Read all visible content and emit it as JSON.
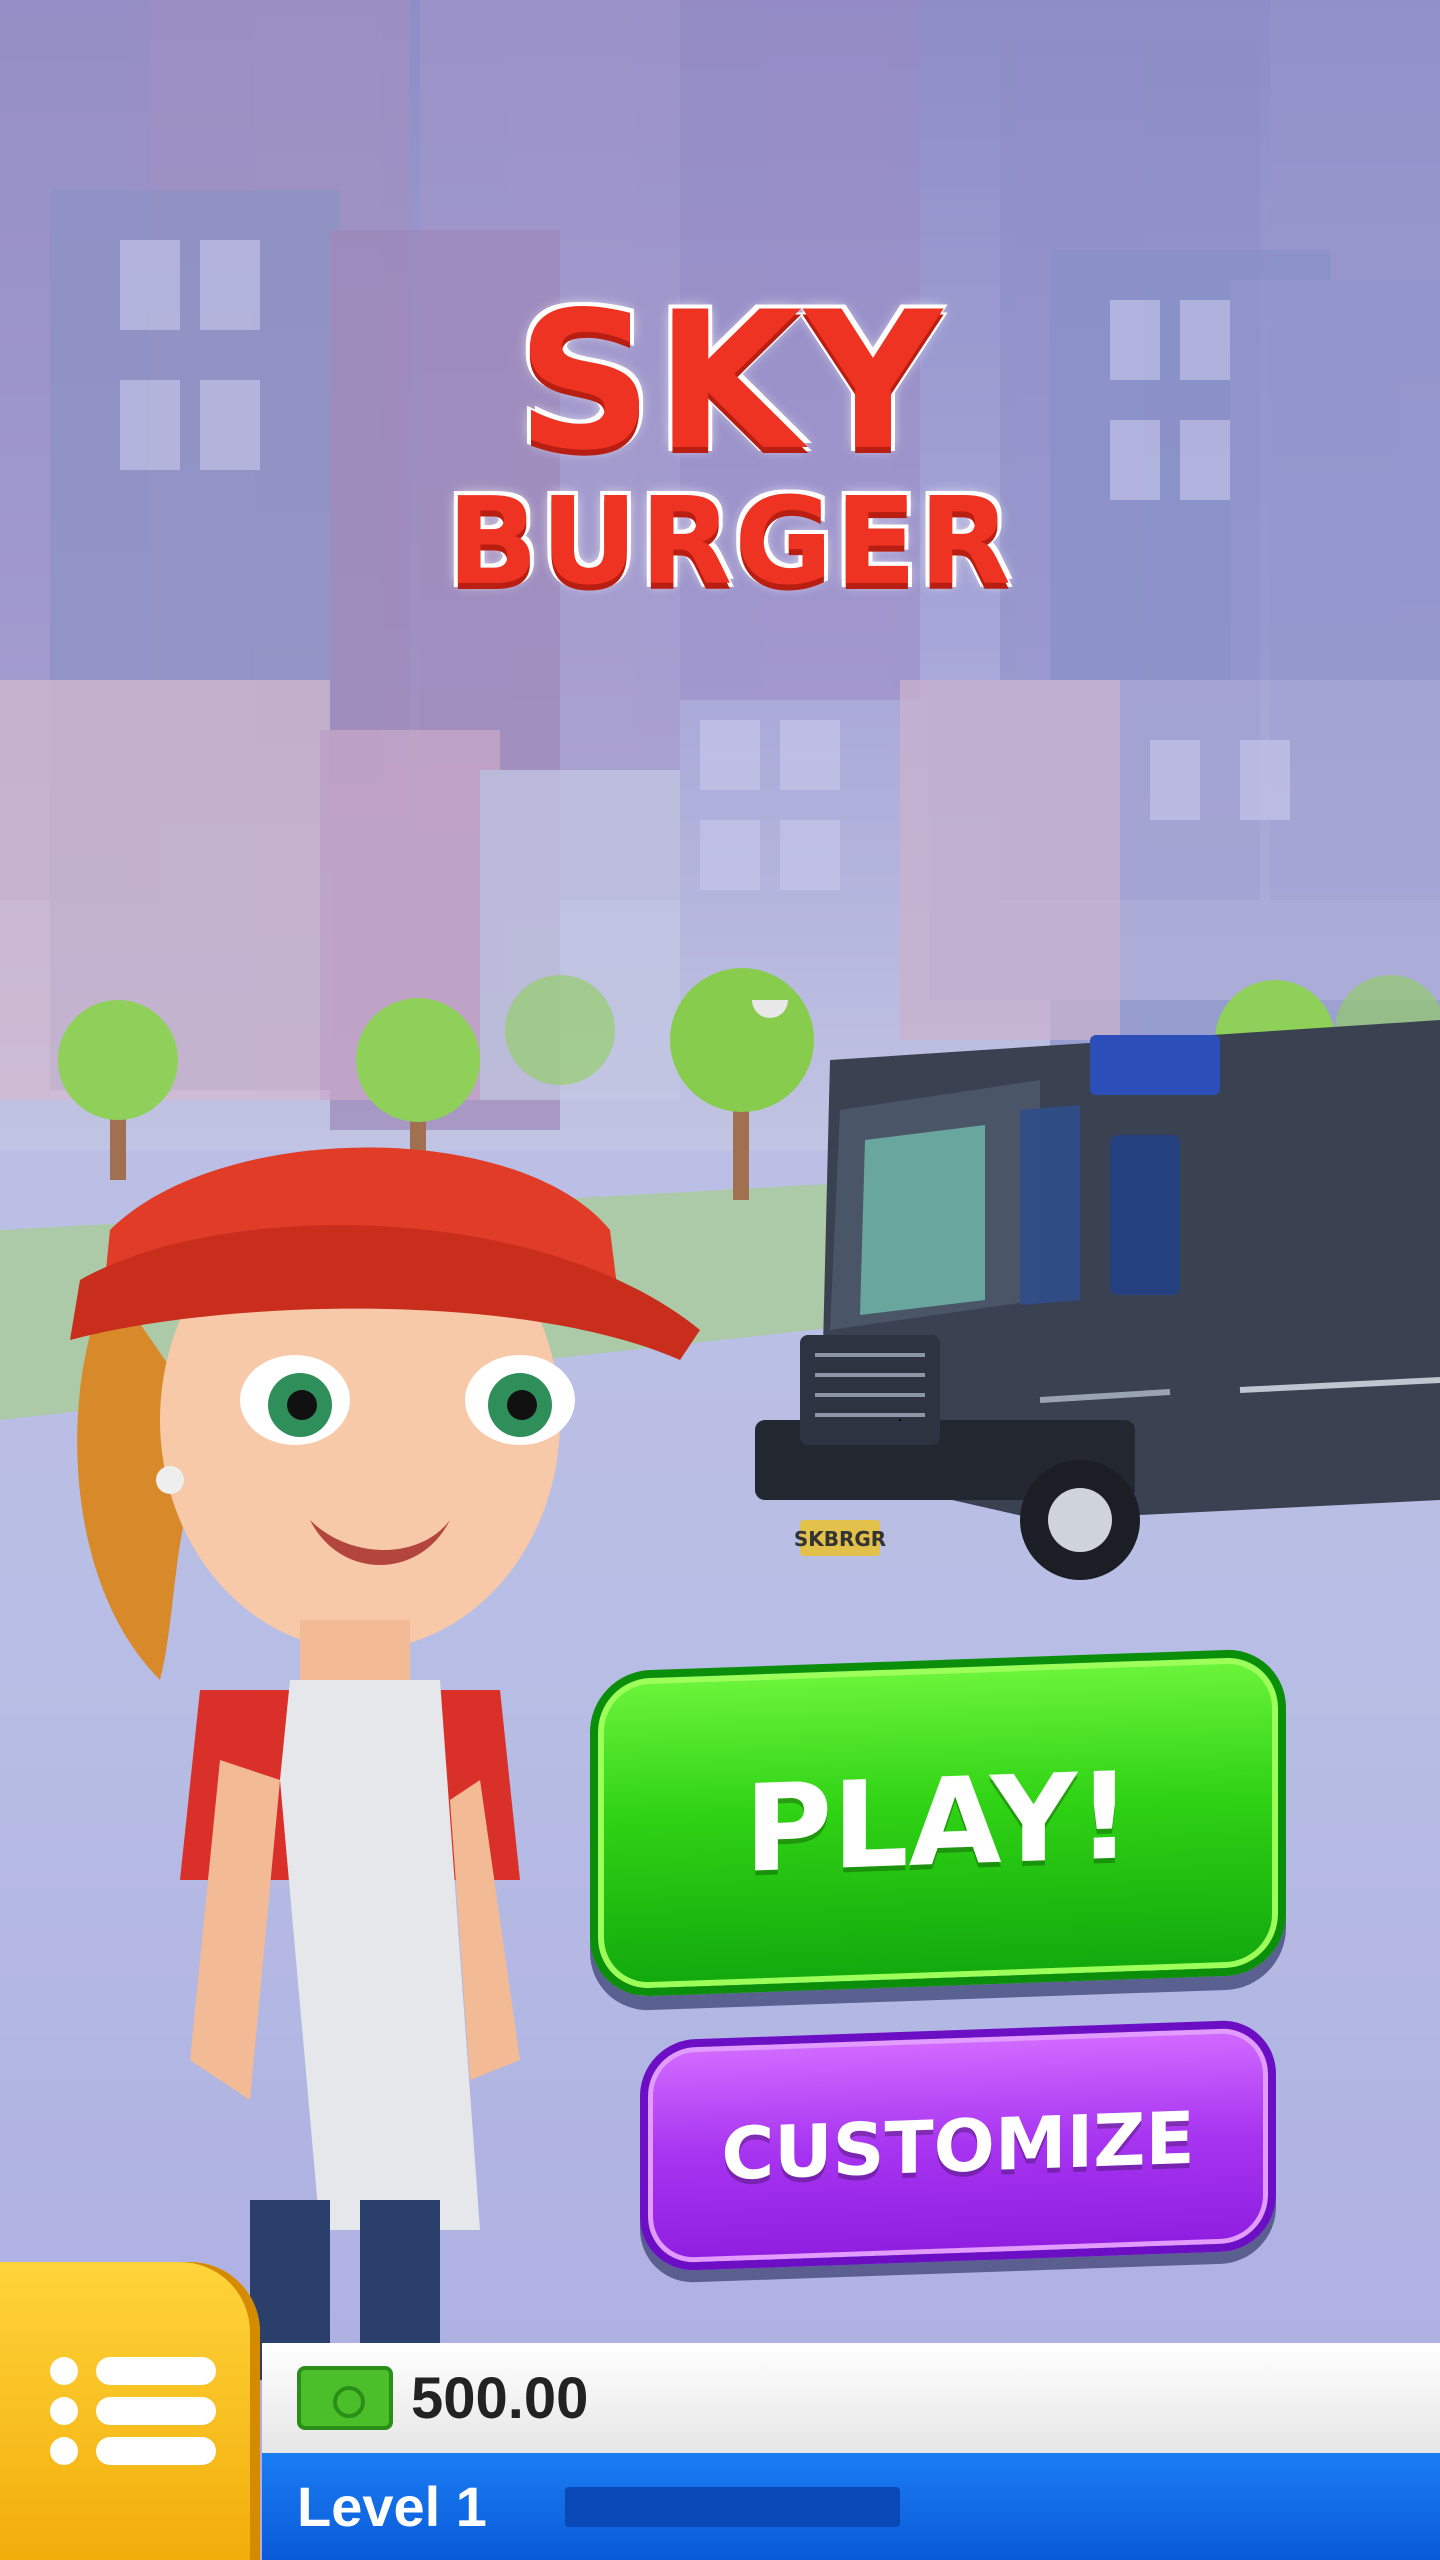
{
  "logo": {
    "line1": "SKY",
    "line2": "BURGER"
  },
  "buttons": {
    "play": "PLAY!",
    "customize": "CUSTOMIZE"
  },
  "hud": {
    "money": "500.00",
    "level": "Level 1",
    "level_progress": 0
  },
  "icons": {
    "menu": "menu-list-icon",
    "money": "cash-icon"
  },
  "truck": {
    "plate": "SKBRGR"
  }
}
